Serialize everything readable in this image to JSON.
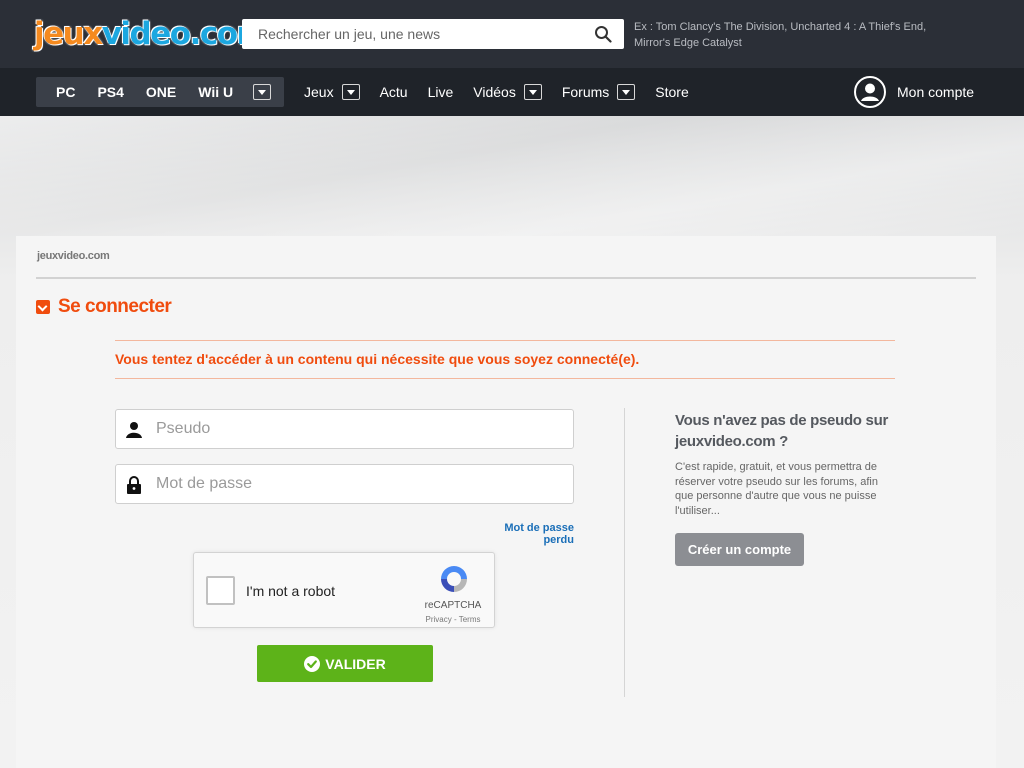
{
  "header": {
    "logo_part1": "jeux",
    "logo_part2": "video.com",
    "search_placeholder": "Rechercher un jeu, une news",
    "search_hint": "Ex : Tom Clancy's The Division, Uncharted 4 : A Thief's End, Mirror's Edge Catalyst"
  },
  "nav": {
    "platforms": [
      "PC",
      "PS4",
      "ONE",
      "Wii U"
    ],
    "menu": [
      {
        "label": "Jeux",
        "dropdown": true
      },
      {
        "label": "Actu",
        "dropdown": false
      },
      {
        "label": "Live",
        "dropdown": false
      },
      {
        "label": "Vidéos",
        "dropdown": true
      },
      {
        "label": "Forums",
        "dropdown": true
      },
      {
        "label": "Store",
        "dropdown": false
      }
    ],
    "account_label": "Mon compte"
  },
  "page": {
    "breadcrumb": "jeuxvideo.com",
    "title": "Se connecter",
    "notice": "Vous tentez d'accéder à un contenu qui nécessite que vous soyez connecté(e)."
  },
  "form": {
    "username_placeholder": "Pseudo",
    "password_placeholder": "Mot de passe",
    "lost_password": "Mot de passe perdu",
    "captcha_label": "I'm not a robot",
    "captcha_brand": "reCAPTCHA",
    "captcha_terms": "Privacy - Terms",
    "submit_label": "VALIDER"
  },
  "sidebar": {
    "title": "Vous n'avez pas de pseudo sur jeuxvideo.com ?",
    "text": "C'est rapide, gratuit, et vous permettra de réserver votre pseudo sur les forums, afin que personne d'autre que vous ne puisse l'utiliser...",
    "create_label": "Créer un compte"
  },
  "colors": {
    "accent": "#f04c0e",
    "header_bg": "#2b2f37",
    "nav_bg": "#1f2329",
    "validate": "#5db319",
    "link": "#1b6fb8"
  }
}
